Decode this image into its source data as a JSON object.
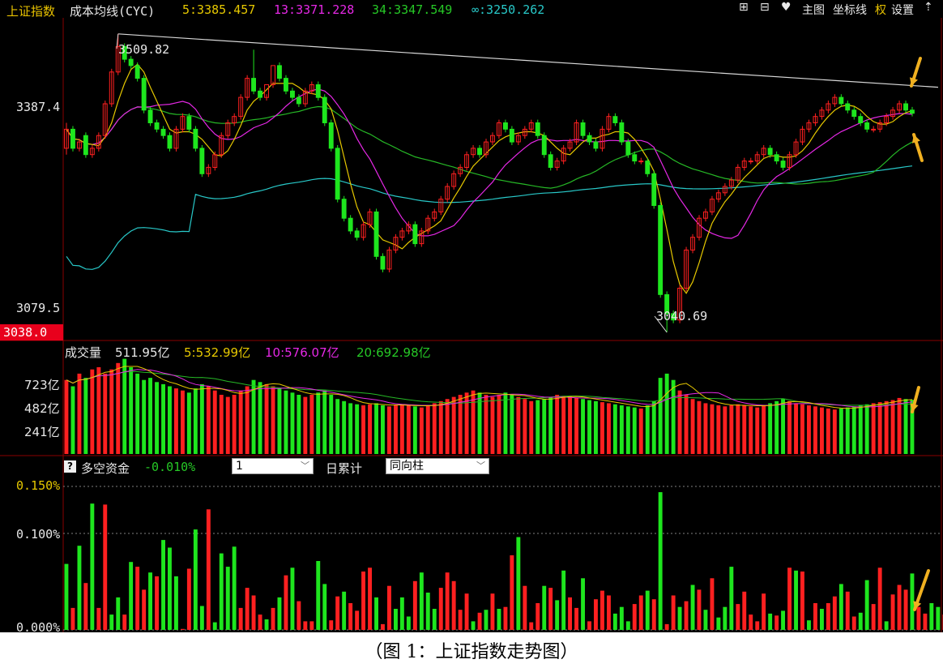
{
  "header": {
    "index_name": "上证指数",
    "indicator": "成本均线(CYC)",
    "ma5": "5:3385.457",
    "ma13": "13:3371.228",
    "ma34": "34:3347.549",
    "ma_inf": "∞:3250.262",
    "toolbar": {
      "plus": "⊞",
      "minus": "⊟",
      "heart": "♥",
      "main_chart": "主图",
      "axis": "坐标线",
      "rights": "权",
      "settings": "设置",
      "up": "⇡"
    }
  },
  "price_axis": {
    "label_high": "3387.4",
    "label_low": "3079.5",
    "current_box": "3038.0"
  },
  "annotations": {
    "high": "3509.82",
    "low": "3040.69"
  },
  "volume": {
    "title": "成交量",
    "value": "511.95亿",
    "ma5": "5:532.99亿",
    "ma10": "10:576.07亿",
    "ma20": "20:692.98亿",
    "ticks": [
      "723亿",
      "482亿",
      "241亿"
    ]
  },
  "flow": {
    "help_icon": "?",
    "title": "多空资金",
    "value": "-0.010%",
    "period_select": "1",
    "mode_label": "日累计",
    "bar_select": "同向柱",
    "ticks": [
      "0.150%",
      "0.100%",
      "0.000%"
    ]
  },
  "caption": "（图 1：上证指数走势图）",
  "colors": {
    "up": "#ff2020",
    "down": "#1ee61e",
    "ma5": "#e6c800",
    "ma13": "#e628e6",
    "ma34": "#26b826",
    "ma_inf": "#28c8c8",
    "panel_border": "#8a0000",
    "arrow": "#f0b020"
  },
  "chart_data": {
    "type": "candlestick",
    "title": "上证指数",
    "y_labels_shown": [
      3387.4,
      3079.5,
      3038.0
    ],
    "ylim": [
      3038.0,
      3530.0
    ],
    "annotated_high": 3509.82,
    "annotated_low": 3040.69,
    "moving_averages": {
      "MA5": 3385.457,
      "MA13": 3371.228,
      "MA34": 3347.549,
      "MA∞": 3250.262
    },
    "price_series": {
      "close": [
        3360,
        3330,
        3340,
        3320,
        3330,
        3350,
        3400,
        3450,
        3490,
        3470,
        3460,
        3440,
        3390,
        3370,
        3360,
        3350,
        3330,
        3360,
        3380,
        3360,
        3330,
        3290,
        3300,
        3320,
        3350,
        3370,
        3380,
        3410,
        3440,
        3420,
        3410,
        3430,
        3460,
        3440,
        3420,
        3410,
        3400,
        3420,
        3430,
        3410,
        3370,
        3330,
        3250,
        3220,
        3200,
        3190,
        3210,
        3230,
        3160,
        3140,
        3170,
        3190,
        3200,
        3210,
        3180,
        3200,
        3220,
        3230,
        3250,
        3270,
        3290,
        3300,
        3320,
        3330,
        3320,
        3340,
        3350,
        3370,
        3360,
        3340,
        3350,
        3360,
        3370,
        3350,
        3320,
        3300,
        3310,
        3330,
        3340,
        3370,
        3350,
        3340,
        3330,
        3360,
        3380,
        3370,
        3340,
        3320,
        3310,
        3310,
        3290,
        3240,
        3100,
        3070,
        3060,
        3110,
        3170,
        3190,
        3220,
        3230,
        3250,
        3260,
        3270,
        3280,
        3300,
        3310,
        3310,
        3320,
        3330,
        3320,
        3310,
        3300,
        3320,
        3340,
        3360,
        3370,
        3380,
        3390,
        3400,
        3410,
        3400,
        3390,
        3380,
        3370,
        3360,
        3360,
        3370,
        3380,
        3390,
        3400,
        3390,
        3385
      ],
      "open": [
        3330,
        3360,
        3330,
        3350,
        3320,
        3330,
        3350,
        3400,
        3450,
        3490,
        3470,
        3460,
        3440,
        3390,
        3370,
        3360,
        3350,
        3330,
        3360,
        3380,
        3360,
        3330,
        3290,
        3300,
        3320,
        3350,
        3370,
        3380,
        3410,
        3440,
        3420,
        3410,
        3430,
        3460,
        3440,
        3420,
        3410,
        3400,
        3420,
        3430,
        3410,
        3370,
        3330,
        3250,
        3220,
        3200,
        3190,
        3210,
        3230,
        3160,
        3140,
        3170,
        3190,
        3200,
        3210,
        3180,
        3200,
        3220,
        3230,
        3250,
        3270,
        3290,
        3300,
        3320,
        3330,
        3320,
        3340,
        3350,
        3370,
        3360,
        3340,
        3350,
        3360,
        3370,
        3350,
        3320,
        3300,
        3310,
        3330,
        3340,
        3370,
        3350,
        3340,
        3330,
        3360,
        3380,
        3370,
        3340,
        3320,
        3310,
        3310,
        3290,
        3240,
        3100,
        3070,
        3060,
        3110,
        3170,
        3190,
        3220,
        3230,
        3250,
        3260,
        3270,
        3280,
        3300,
        3310,
        3310,
        3320,
        3330,
        3320,
        3310,
        3300,
        3320,
        3340,
        3360,
        3370,
        3380,
        3390,
        3400,
        3410,
        3400,
        3390,
        3380,
        3370,
        3360,
        3360,
        3370,
        3380,
        3390,
        3400,
        3390
      ],
      "high": [
        3370,
        3365,
        3345,
        3355,
        3335,
        3355,
        3405,
        3455,
        3509.82,
        3495,
        3475,
        3465,
        3445,
        3395,
        3375,
        3365,
        3355,
        3365,
        3385,
        3385,
        3365,
        3335,
        3305,
        3325,
        3355,
        3375,
        3385,
        3415,
        3445,
        3485,
        3425,
        3415,
        3435,
        3465,
        3445,
        3425,
        3415,
        3425,
        3435,
        3435,
        3415,
        3375,
        3335,
        3255,
        3225,
        3205,
        3215,
        3235,
        3235,
        3165,
        3175,
        3195,
        3205,
        3215,
        3215,
        3205,
        3225,
        3235,
        3255,
        3275,
        3295,
        3305,
        3325,
        3335,
        3335,
        3345,
        3355,
        3375,
        3375,
        3365,
        3355,
        3365,
        3375,
        3375,
        3355,
        3325,
        3315,
        3335,
        3345,
        3375,
        3375,
        3355,
        3345,
        3365,
        3385,
        3385,
        3375,
        3345,
        3325,
        3315,
        3315,
        3295,
        3245,
        3105,
        3075,
        3115,
        3175,
        3195,
        3225,
        3235,
        3255,
        3265,
        3275,
        3285,
        3305,
        3315,
        3315,
        3325,
        3335,
        3335,
        3325,
        3315,
        3325,
        3345,
        3365,
        3375,
        3385,
        3395,
        3405,
        3415,
        3415,
        3405,
        3395,
        3385,
        3375,
        3365,
        3375,
        3385,
        3395,
        3405,
        3405,
        3395
      ],
      "low": [
        3320,
        3325,
        3325,
        3315,
        3315,
        3325,
        3345,
        3395,
        3445,
        3465,
        3455,
        3435,
        3385,
        3365,
        3355,
        3345,
        3325,
        3325,
        3355,
        3355,
        3325,
        3285,
        3285,
        3295,
        3315,
        3345,
        3365,
        3375,
        3405,
        3415,
        3405,
        3405,
        3425,
        3435,
        3415,
        3405,
        3395,
        3395,
        3415,
        3405,
        3365,
        3325,
        3245,
        3215,
        3195,
        3185,
        3185,
        3205,
        3155,
        3135,
        3135,
        3165,
        3185,
        3195,
        3175,
        3175,
        3195,
        3215,
        3225,
        3245,
        3265,
        3285,
        3295,
        3315,
        3315,
        3315,
        3335,
        3345,
        3355,
        3335,
        3335,
        3345,
        3355,
        3345,
        3315,
        3295,
        3295,
        3305,
        3325,
        3335,
        3345,
        3335,
        3325,
        3325,
        3355,
        3365,
        3335,
        3315,
        3305,
        3305,
        3285,
        3235,
        3095,
        3040.69,
        3055,
        3055,
        3105,
        3165,
        3185,
        3215,
        3225,
        3245,
        3255,
        3265,
        3275,
        3295,
        3305,
        3305,
        3315,
        3315,
        3305,
        3295,
        3295,
        3315,
        3335,
        3355,
        3365,
        3375,
        3385,
        3395,
        3395,
        3385,
        3375,
        3365,
        3355,
        3355,
        3355,
        3365,
        3375,
        3385,
        3385,
        3380
      ]
    },
    "volume_series_yi": [
      700,
      640,
      760,
      720,
      800,
      820,
      760,
      800,
      860,
      900,
      820,
      760,
      700,
      720,
      680,
      660,
      640,
      620,
      600,
      580,
      620,
      660,
      640,
      600,
      560,
      540,
      560,
      600,
      640,
      700,
      680,
      660,
      640,
      620,
      600,
      580,
      560,
      540,
      560,
      580,
      600,
      560,
      520,
      500,
      480,
      470,
      460,
      470,
      480,
      460,
      450,
      460,
      470,
      460,
      450,
      440,
      460,
      480,
      500,
      520,
      540,
      560,
      580,
      600,
      580,
      560,
      540,
      560,
      580,
      560,
      540,
      520,
      500,
      510,
      520,
      540,
      560,
      550,
      540,
      530,
      520,
      510,
      500,
      490,
      480,
      470,
      460,
      450,
      440,
      430,
      460,
      500,
      720,
      760,
      700,
      600,
      560,
      520,
      500,
      480,
      470,
      460,
      450,
      460,
      470,
      460,
      450,
      440,
      460,
      480,
      500,
      520,
      500,
      480,
      470,
      460,
      450,
      440,
      430,
      420,
      430,
      440,
      450,
      460,
      470,
      480,
      490,
      500,
      510,
      530,
      520,
      512
    ],
    "flow_series_pct": [
      0.069,
      -0.023,
      0.088,
      -0.049,
      0.132,
      -0.023,
      -0.131,
      0.016,
      0.034,
      -0.016,
      0.071,
      -0.066,
      -0.042,
      0.06,
      -0.056,
      0.094,
      0.086,
      0.056,
      -0.001,
      -0.064,
      0.105,
      0.025,
      -0.126,
      0.008,
      0.08,
      0.066,
      0.087,
      -0.023,
      -0.044,
      -0.036,
      -0.016,
      0.011,
      -0.023,
      0.034,
      -0.057,
      0.065,
      -0.03,
      -0.009,
      -0.009,
      0.072,
      0.048,
      -0.01,
      -0.035,
      0.04,
      -0.028,
      -0.02,
      -0.061,
      -0.065,
      0.034,
      -0.006,
      -0.046,
      0.022,
      0.034,
      0.014,
      -0.051,
      0.06,
      0.039,
      0.022,
      -0.044,
      -0.06,
      -0.051,
      -0.021,
      -0.038,
      0.009,
      -0.018,
      0.021,
      -0.038,
      0.022,
      -0.024,
      -0.078,
      0.097,
      -0.046,
      -0.008,
      -0.028,
      0.046,
      -0.044,
      0.031,
      0.062,
      -0.034,
      -0.023,
      0.054,
      -0.009,
      -0.032,
      -0.041,
      -0.036,
      0.017,
      0.024,
      0.009,
      -0.027,
      -0.036,
      0.041,
      -0.032,
      0.144,
      -0.006,
      -0.036,
      0.024,
      -0.03,
      0.047,
      -0.042,
      0.021,
      -0.054,
      0.013,
      0.024,
      0.066,
      -0.027,
      -0.04,
      -0.016,
      -0.009,
      -0.038,
      0.017,
      -0.015,
      0.02,
      -0.065,
      0.062,
      -0.061,
      0.01,
      -0.028,
      0.022,
      -0.028,
      -0.035,
      0.048,
      -0.04,
      -0.014,
      0.018,
      0.052,
      -0.027,
      -0.065,
      0.009,
      -0.037,
      -0.047,
      -0.042,
      0.059,
      -0.024,
      -0.017,
      0.028,
      0.024,
      -0.016
    ]
  }
}
